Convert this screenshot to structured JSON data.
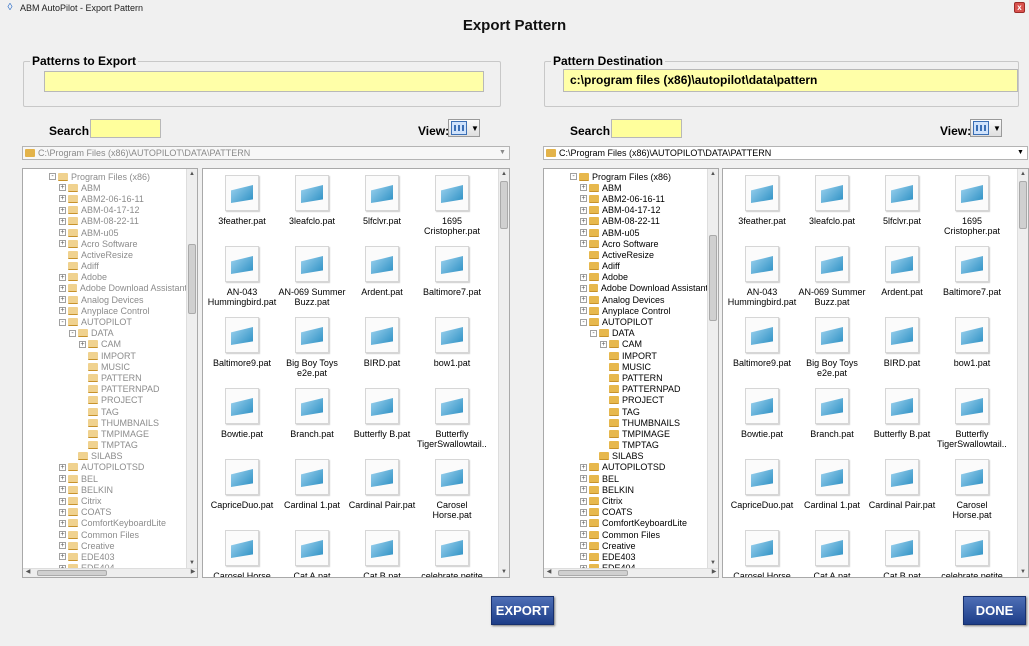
{
  "window": {
    "title": "ABM AutoPilot - Export Pattern",
    "close_glyph": "x"
  },
  "page_title": "Export Pattern",
  "left": {
    "group_label": "Patterns to Export",
    "field_value": "",
    "search_label": "Search:",
    "search_value": "",
    "view_label": "View:",
    "path": "C:\\Program Files (x86)\\AUTOPILOT\\DATA\\PATTERN"
  },
  "right": {
    "group_label": "Pattern Destination",
    "field_value": "c:\\program files (x86)\\autopilot\\data\\pattern",
    "search_label": "Search:",
    "search_value": "",
    "view_label": "View:",
    "path": "C:\\Program Files (x86)\\AUTOPILOT\\DATA\\PATTERN"
  },
  "tree": [
    {
      "label": "Program Files (x86)",
      "level": 0,
      "exp": "-"
    },
    {
      "label": "ABM",
      "level": 1,
      "exp": "+"
    },
    {
      "label": "ABM2-06-16-11",
      "level": 1,
      "exp": "+"
    },
    {
      "label": "ABM-04-17-12",
      "level": 1,
      "exp": "+"
    },
    {
      "label": "ABM-08-22-11",
      "level": 1,
      "exp": "+"
    },
    {
      "label": "ABM-u05",
      "level": 1,
      "exp": "+"
    },
    {
      "label": "Acro Software",
      "level": 1,
      "exp": "+"
    },
    {
      "label": "ActiveResize",
      "level": 1,
      "exp": ""
    },
    {
      "label": "Adiff",
      "level": 1,
      "exp": ""
    },
    {
      "label": "Adobe",
      "level": 1,
      "exp": "+"
    },
    {
      "label": "Adobe Download Assistant",
      "level": 1,
      "exp": "+"
    },
    {
      "label": "Analog Devices",
      "level": 1,
      "exp": "+"
    },
    {
      "label": "Anyplace Control",
      "level": 1,
      "exp": "+"
    },
    {
      "label": "AUTOPILOT",
      "level": 1,
      "exp": "-"
    },
    {
      "label": "DATA",
      "level": 2,
      "exp": "-"
    },
    {
      "label": "CAM",
      "level": 3,
      "exp": "+"
    },
    {
      "label": "IMPORT",
      "level": 3,
      "exp": ""
    },
    {
      "label": "MUSIC",
      "level": 3,
      "exp": ""
    },
    {
      "label": "PATTERN",
      "level": 3,
      "exp": ""
    },
    {
      "label": "PATTERNPAD",
      "level": 3,
      "exp": ""
    },
    {
      "label": "PROJECT",
      "level": 3,
      "exp": ""
    },
    {
      "label": "TAG",
      "level": 3,
      "exp": ""
    },
    {
      "label": "THUMBNAILS",
      "level": 3,
      "exp": ""
    },
    {
      "label": "TMPIMAGE",
      "level": 3,
      "exp": ""
    },
    {
      "label": "TMPTAG",
      "level": 3,
      "exp": ""
    },
    {
      "label": "SILABS",
      "level": 2,
      "exp": ""
    },
    {
      "label": "AUTOPILOTSD",
      "level": 1,
      "exp": "+"
    },
    {
      "label": "BEL",
      "level": 1,
      "exp": "+"
    },
    {
      "label": "BELKIN",
      "level": 1,
      "exp": "+"
    },
    {
      "label": "Citrix",
      "level": 1,
      "exp": "+"
    },
    {
      "label": "COATS",
      "level": 1,
      "exp": "+"
    },
    {
      "label": "ComfortKeyboardLite",
      "level": 1,
      "exp": "+"
    },
    {
      "label": "Common Files",
      "level": 1,
      "exp": "+"
    },
    {
      "label": "Creative",
      "level": 1,
      "exp": "+"
    },
    {
      "label": "EDE403",
      "level": 1,
      "exp": "+"
    },
    {
      "label": "EDE404",
      "level": 1,
      "exp": "+"
    }
  ],
  "files": [
    "3feather.pat",
    "3leafclo.pat",
    "5lfclvr.pat",
    "1695 Cristopher.pat",
    "AN-043 Hummingbird.pat",
    "AN-069 Summer Buzz.pat",
    "Ardent.pat",
    "Baltimore7.pat",
    "Baltimore9.pat",
    "Big Boy Toys e2e.pat",
    "BIRD.pat",
    "bow1.pat",
    "Bowtie.pat",
    "Branch.pat",
    "Butterfly B.pat",
    "Butterfly TigerSwallowtail....",
    "CapriceDuo.pat",
    "Cardinal 1.pat",
    "Cardinal Pair.pat",
    "Carosel Horse.pat",
    "Carosel Horse",
    "Cat A.pat",
    "Cat B.pat",
    "celebrate petite"
  ],
  "buttons": {
    "export": "EXPORT",
    "done": "DONE"
  },
  "icons": {
    "app": "app-icon",
    "file": "pattern-file-icon",
    "folder": "folder-icon",
    "view": "view-details-icon"
  }
}
